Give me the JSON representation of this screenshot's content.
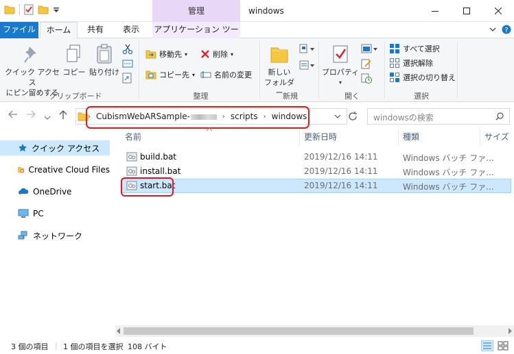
{
  "window": {
    "title": "windows",
    "context_tab": "管理"
  },
  "ribbon_tabs": [
    {
      "label": "ファイル"
    },
    {
      "label": "ホーム"
    },
    {
      "label": "共有"
    },
    {
      "label": "表示"
    },
    {
      "label": "アプリケーション ツール"
    }
  ],
  "ribbon": {
    "clipboard": {
      "pin_label_1": "クイック アクセス",
      "pin_label_2": "にピン留めする",
      "copy": "コピー",
      "paste": "貼り付け",
      "group": "クリップボード"
    },
    "organize": {
      "move_to": "移動先",
      "copy_to": "コピー先",
      "delete": "削除",
      "rename": "名前の変更",
      "group": "整理"
    },
    "new": {
      "new_folder_1": "新しい",
      "new_folder_2": "フォルダー",
      "group": "新規"
    },
    "open": {
      "properties": "プロパティ",
      "group": "開く"
    },
    "select": {
      "select_all": "すべて選択",
      "select_none": "選択解除",
      "invert": "選択の切り替え",
      "group": "選択"
    }
  },
  "address": {
    "crumbs": [
      "CubismWebARSample-",
      "scripts",
      "windows"
    ],
    "search_placeholder": "windowsの検索"
  },
  "nav": [
    {
      "label": "クイック アクセス",
      "icon": "star-icon"
    },
    {
      "label": "Creative Cloud Files",
      "icon": "creative-cloud-icon"
    },
    {
      "label": "OneDrive",
      "icon": "cloud-icon"
    },
    {
      "label": "PC",
      "icon": "pc-icon"
    },
    {
      "label": "ネットワーク",
      "icon": "network-icon"
    }
  ],
  "columns": [
    "名前",
    "更新日時",
    "種類",
    "サイズ"
  ],
  "files": [
    {
      "name": "build.bat",
      "date": "2019/12/16 14:11",
      "type": "Windows バッチ ファ..."
    },
    {
      "name": "install.bat",
      "date": "2019/12/16 14:11",
      "type": "Windows バッチ ファ..."
    },
    {
      "name": "start.bat",
      "date": "2019/12/16 14:11",
      "type": "Windows バッチ ファ..."
    }
  ],
  "status": {
    "count": "3 個の項目",
    "selection": "1 個の項目を選択",
    "size": "108 バイト"
  },
  "colors": {
    "accent": "#1979ca",
    "selection": "#cce8ff",
    "highlight": "#e0191c",
    "context_tab": "#e8d7f7"
  }
}
